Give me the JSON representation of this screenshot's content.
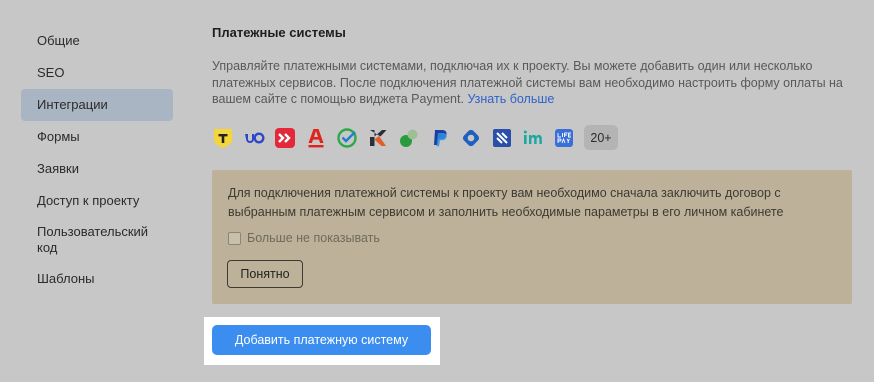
{
  "sidebar": {
    "items": [
      {
        "label": "Общие"
      },
      {
        "label": "SEO"
      },
      {
        "label": "Интеграции"
      },
      {
        "label": "Формы"
      },
      {
        "label": "Заявки"
      },
      {
        "label": "Доступ к проекту"
      },
      {
        "label": "Пользовательский код"
      },
      {
        "label": "Шаблоны"
      }
    ]
  },
  "section": {
    "title": "Платежные системы",
    "description": "Управляйте платежными системами, подключая их к проекту. Вы можете добавить один или несколько платежных сервисов. После подключения платежной системы вам необходимо настроить форму оплаты на вашем сайте с помощью виджета Payment.",
    "learn_more": "Узнать больше"
  },
  "payment_logos": {
    "icons": [
      "tinkoff-logo",
      "yoomoney-logo",
      "prodamus-logo",
      "alfabank-logo",
      "sberbank-logo",
      "cloudpayments-logo",
      "green-bubbles-logo",
      "paypal-logo",
      "diamond-pay-logo",
      "robokassa-logo",
      "im-logo",
      "life-pay-logo"
    ],
    "more_count": "20+",
    "colors": {
      "tinkoff": "#f5d63a",
      "yoomoney": "#2e47c9",
      "prodamus": "#e3283a",
      "alfa": "#e2221d",
      "sber": "#2fa84a",
      "paypal": "#1d3ea1",
      "life_pay": "#3b6fd8"
    }
  },
  "notice": {
    "text": "Для подключения платежной системы к проекту вам необходимо сначала заключить договор с выбранным платежным сервисом и заполнить необходимые параметры в его личном кабинете",
    "checkbox_label": "Больше не показывать",
    "checkbox_checked": false,
    "ok_label": "Понятно"
  },
  "actions": {
    "add_label": "Добавить платежную систему"
  },
  "colors": {
    "overlay_bg": "#c7c7c7",
    "active_nav": "#a9b5c2",
    "notice_bg": "#bdb299",
    "primary": "#3b8ef0",
    "link": "#2f62c8"
  }
}
